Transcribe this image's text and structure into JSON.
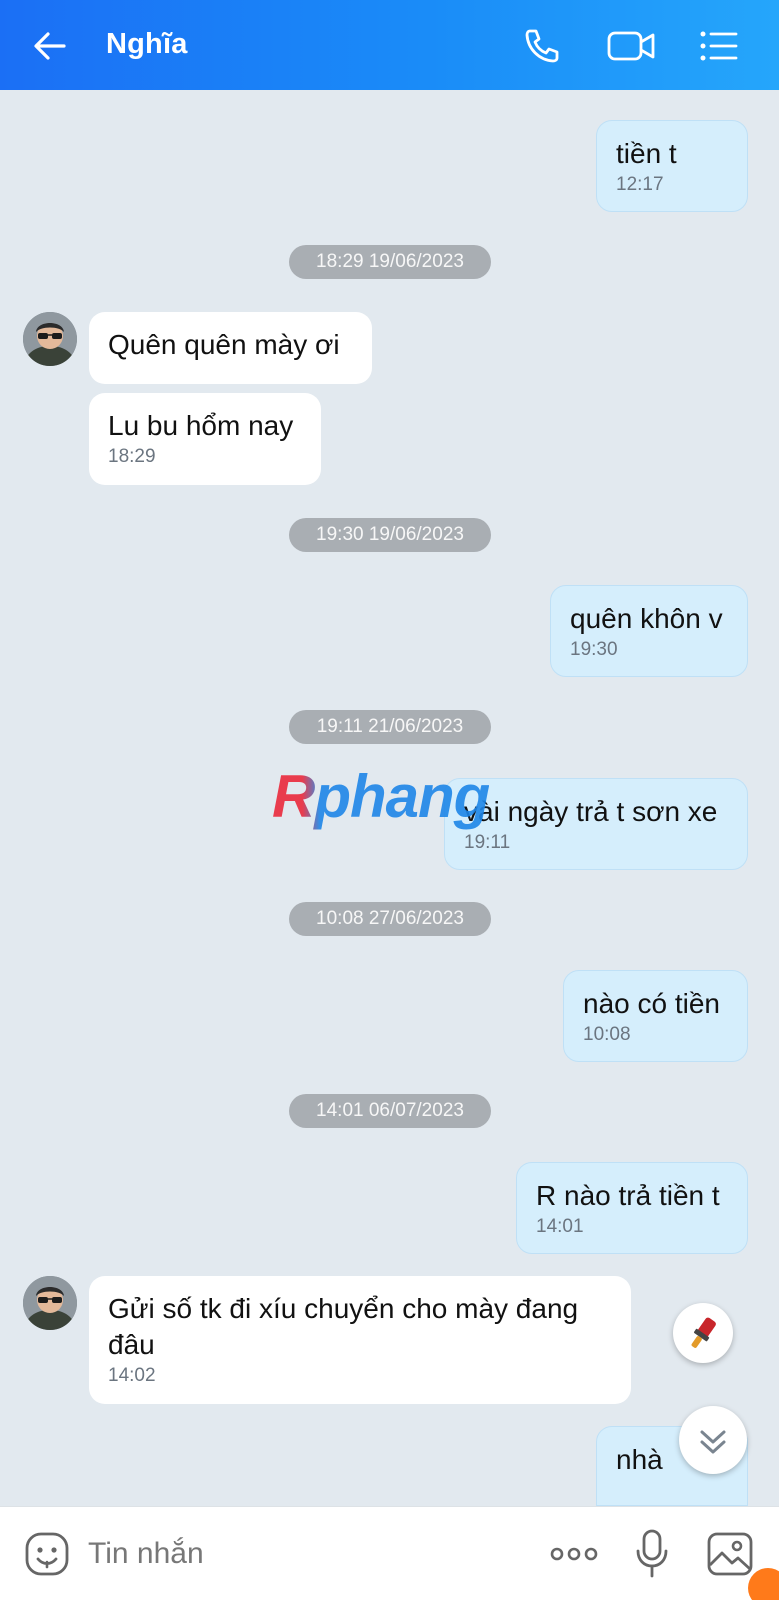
{
  "header": {
    "contact_name": "Nghĩa"
  },
  "messages": [
    {
      "text": "tiền t",
      "time": "12:17"
    },
    {
      "text": "Quên quên mày ơi"
    },
    {
      "text": "Lu bu hổm nay",
      "time": "18:29"
    },
    {
      "text": "quên khôn v",
      "time": "19:30"
    },
    {
      "text": "vài ngày trả t sơn xe",
      "time": "19:11"
    },
    {
      "text": "nào có tiền",
      "time": "10:08"
    },
    {
      "text": "R nào trả tiền t",
      "time": "14:01"
    },
    {
      "text": "Gửi số tk đi xíu chuyển cho mày đang đâu",
      "time": "14:02"
    },
    {
      "text": "nhà"
    }
  ],
  "timestamps": [
    "18:29 19/06/2023",
    "19:30 19/06/2023",
    "19:11 21/06/2023",
    "10:08 27/06/2023",
    "14:01 06/07/2023"
  ],
  "watermark": "Rphang",
  "composer": {
    "placeholder": "Tin nhắn"
  },
  "colors": {
    "header_start": "#1b6ff5",
    "header_end": "#25a6fb",
    "outgoing_bubble": "#d5eefc",
    "incoming_bubble": "#ffffff",
    "chat_bg": "#e2e9ef"
  },
  "icons": [
    "back-arrow-icon",
    "phone-icon",
    "video-call-icon",
    "menu-list-icon",
    "sticker-icon",
    "more-icon",
    "microphone-icon",
    "image-icon",
    "quick-reaction-icon",
    "scroll-down-icon"
  ]
}
